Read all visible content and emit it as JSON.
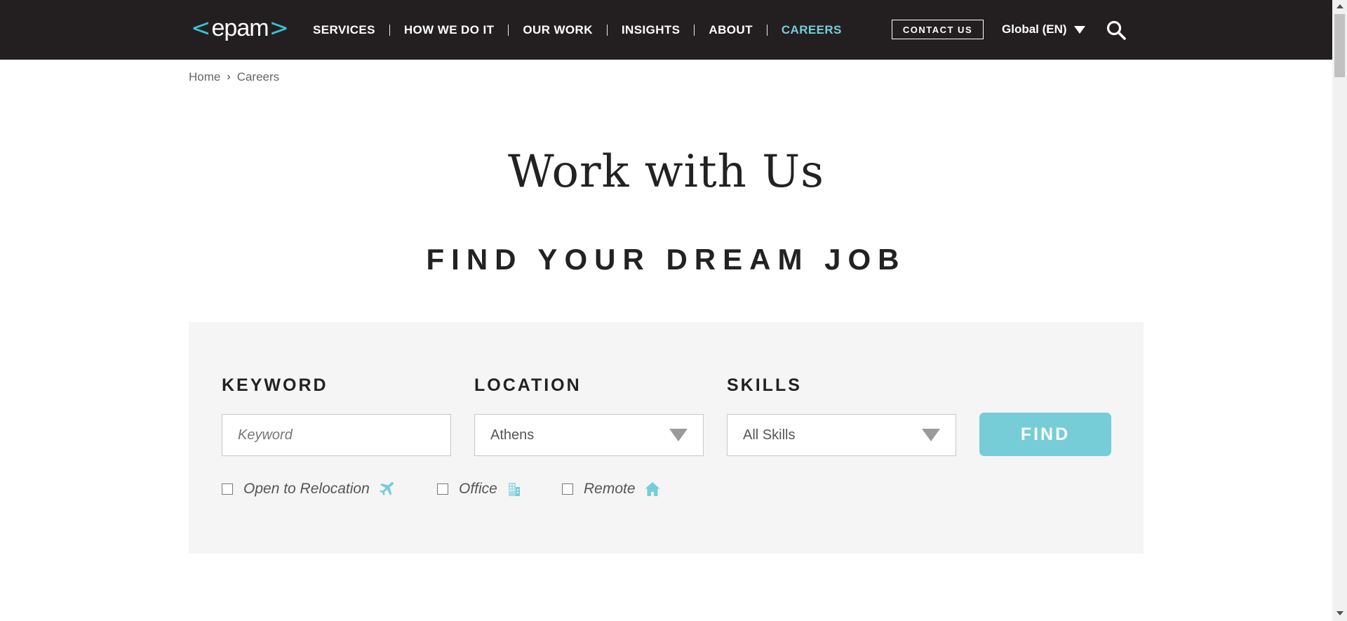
{
  "header": {
    "logo": {
      "left": "<",
      "word": "epam",
      "right": ">"
    },
    "nav": [
      {
        "label": "SERVICES"
      },
      {
        "label": "HOW WE DO IT"
      },
      {
        "label": "OUR WORK"
      },
      {
        "label": "INSIGHTS"
      },
      {
        "label": "ABOUT"
      },
      {
        "label": "CAREERS",
        "active": true
      }
    ],
    "contact_label": "CONTACT US",
    "language_label": "Global (EN)",
    "search_icon": "search-icon"
  },
  "breadcrumb": {
    "home": "Home",
    "separator": "›",
    "current": "Careers"
  },
  "page_title": "Work with Us",
  "subtitle": "FIND YOUR DREAM JOB",
  "search": {
    "keyword": {
      "label": "KEYWORD",
      "placeholder": "Keyword",
      "value": ""
    },
    "location": {
      "label": "LOCATION",
      "value": "Athens"
    },
    "skills": {
      "label": "SKILLS",
      "value": "All Skills"
    },
    "find_label": "FIND",
    "filters": [
      {
        "label": "Open to Relocation",
        "icon": "airplane-icon",
        "checked": false
      },
      {
        "label": "Office",
        "icon": "building-icon",
        "checked": false
      },
      {
        "label": "Remote",
        "icon": "home-icon",
        "checked": false
      }
    ]
  },
  "colors": {
    "header_bg": "#231f20",
    "accent": "#76cdd8",
    "logo_bracket": "#39c2d7",
    "panel_bg": "#f5f5f5"
  }
}
